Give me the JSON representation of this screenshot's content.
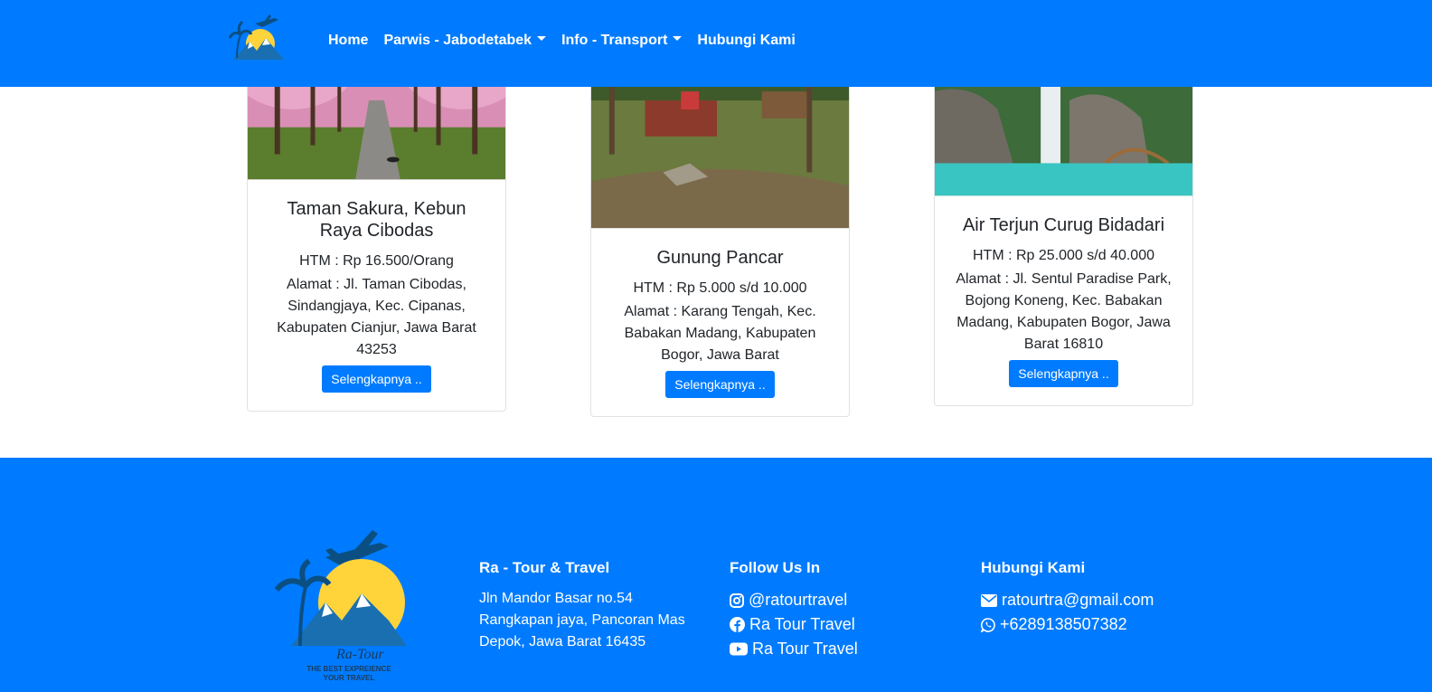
{
  "nav": {
    "links": [
      {
        "label": "Home",
        "dropdown": false
      },
      {
        "label": "Parwis - Jabodetabek",
        "dropdown": true
      },
      {
        "label": "Info - Transport",
        "dropdown": true
      },
      {
        "label": "Hubungi Kami",
        "dropdown": false
      }
    ]
  },
  "cards": [
    {
      "title": "Taman Sakura, Kebun Raya Cibodas",
      "htm": "HTM : Rp 16.500/Orang",
      "address": "Alamat : Jl. Taman Cibodas, Sindangjaya, Kec. Cipanas, Kabupaten Cianjur, Jawa Barat 43253",
      "button": "Selengkapnya .."
    },
    {
      "title": "Gunung Pancar",
      "htm": "HTM : Rp 5.000 s/d 10.000",
      "address": "Alamat : Karang Tengah, Kec. Babakan Madang, Kabupaten Bogor, Jawa Barat",
      "button": "Selengkapnya .."
    },
    {
      "title": "Air Terjun Curug Bidadari",
      "htm": "HTM : Rp 25.000 s/d 40.000",
      "address": "Alamat : Jl. Sentul Paradise Park, Bojong Koneng, Kec. Babakan Madang, Kabupaten Bogor, Jawa Barat 16810",
      "button": "Selengkapnya .."
    }
  ],
  "footer": {
    "logo": {
      "name": "Ra-Tour",
      "tagline_1": "THE BEST EXPREIENCE",
      "tagline_2": "YOUR TRAVEL"
    },
    "company": {
      "title": "Ra - Tour & Travel",
      "address_1": "Jln Mandor Basar no.54",
      "address_2": "Rangkapan jaya, Pancoran Mas",
      "address_3": "Depok, Jawa Barat 16435"
    },
    "follow": {
      "title": "Follow Us In",
      "instagram": "@ratourtravel",
      "facebook": "Ra Tour Travel",
      "youtube": "Ra Tour Travel"
    },
    "contact": {
      "title": "Hubungi Kami",
      "email": "ratourtra@gmail.com",
      "whatsapp": "+6289138507382"
    }
  },
  "colors": {
    "primary": "#007bff"
  }
}
